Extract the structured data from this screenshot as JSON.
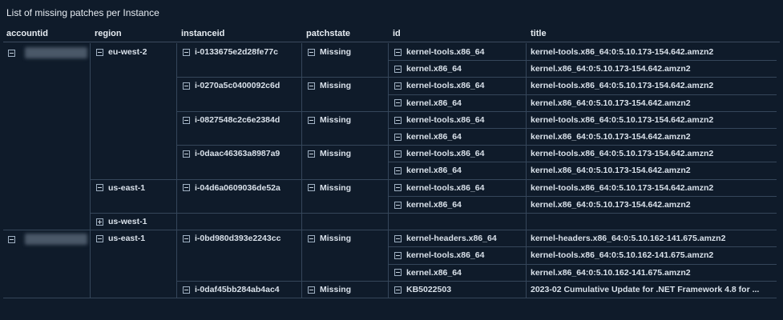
{
  "panel_title": "List of missing patches per Instance",
  "columns": [
    "accountid",
    "region",
    "instanceid",
    "patchstate",
    "id",
    "title"
  ],
  "accounts": [
    {
      "regions": [
        {
          "name": "eu-west-2",
          "expanded": true,
          "instances": [
            {
              "id": "i-0133675e2d28fe77c",
              "state": "Missing",
              "patches": [
                {
                  "id": "kernel-tools.x86_64",
                  "title": "kernel-tools.x86_64:0:5.10.173-154.642.amzn2"
                },
                {
                  "id": "kernel.x86_64",
                  "title": "kernel.x86_64:0:5.10.173-154.642.amzn2"
                }
              ]
            },
            {
              "id": "i-0270a5c0400092c6d",
              "state": "Missing",
              "patches": [
                {
                  "id": "kernel-tools.x86_64",
                  "title": "kernel-tools.x86_64:0:5.10.173-154.642.amzn2"
                },
                {
                  "id": "kernel.x86_64",
                  "title": "kernel.x86_64:0:5.10.173-154.642.amzn2"
                }
              ]
            },
            {
              "id": "i-0827548c2c6e2384d",
              "state": "Missing",
              "patches": [
                {
                  "id": "kernel-tools.x86_64",
                  "title": "kernel-tools.x86_64:0:5.10.173-154.642.amzn2"
                },
                {
                  "id": "kernel.x86_64",
                  "title": "kernel.x86_64:0:5.10.173-154.642.amzn2"
                }
              ]
            },
            {
              "id": "i-0daac46363a8987a9",
              "state": "Missing",
              "patches": [
                {
                  "id": "kernel-tools.x86_64",
                  "title": "kernel-tools.x86_64:0:5.10.173-154.642.amzn2"
                },
                {
                  "id": "kernel.x86_64",
                  "title": "kernel.x86_64:0:5.10.173-154.642.amzn2"
                }
              ]
            }
          ]
        },
        {
          "name": "us-east-1",
          "expanded": true,
          "instances": [
            {
              "id": "i-04d6a0609036de52a",
              "state": "Missing",
              "patches": [
                {
                  "id": "kernel-tools.x86_64",
                  "title": "kernel-tools.x86_64:0:5.10.173-154.642.amzn2"
                },
                {
                  "id": "kernel.x86_64",
                  "title": "kernel.x86_64:0:5.10.173-154.642.amzn2"
                }
              ]
            }
          ]
        },
        {
          "name": "us-west-1",
          "expanded": false,
          "instances": []
        }
      ]
    },
    {
      "regions": [
        {
          "name": "us-east-1",
          "expanded": true,
          "instances": [
            {
              "id": "i-0bd980d393e2243cc",
              "state": "Missing",
              "patches": [
                {
                  "id": "kernel-headers.x86_64",
                  "title": "kernel-headers.x86_64:0:5.10.162-141.675.amzn2"
                },
                {
                  "id": "kernel-tools.x86_64",
                  "title": "kernel-tools.x86_64:0:5.10.162-141.675.amzn2"
                },
                {
                  "id": "kernel.x86_64",
                  "title": "kernel.x86_64:0:5.10.162-141.675.amzn2"
                }
              ]
            },
            {
              "id": "i-0daf45bb284ab4ac4",
              "state": "Missing",
              "patches": [
                {
                  "id": "KB5022503",
                  "title": "2023-02 Cumulative Update for .NET Framework 4.8 for ..."
                }
              ]
            }
          ]
        }
      ]
    }
  ]
}
